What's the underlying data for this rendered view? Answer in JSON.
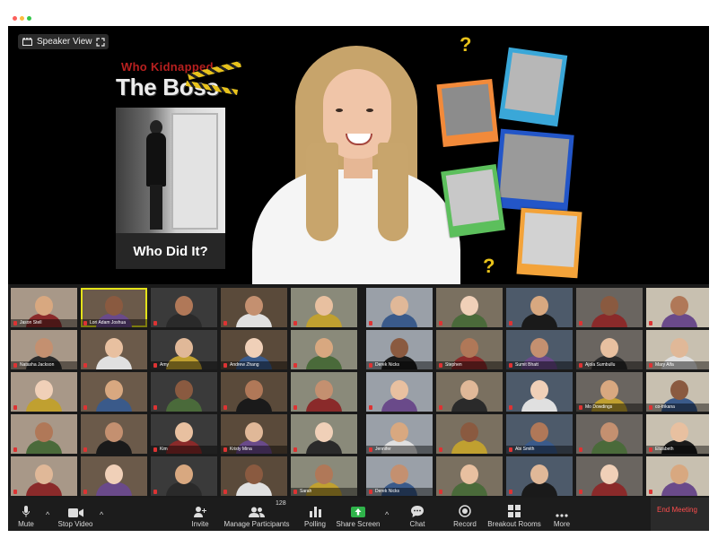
{
  "window": {
    "traffic_lights": [
      "#fc605c",
      "#fdbc40",
      "#34c84a"
    ]
  },
  "top_controls": {
    "speaker_view_label": "Speaker View"
  },
  "poster": {
    "title_line1": "Who Kidnapped",
    "title_line2": "The Boss",
    "caption": "Who Did It?"
  },
  "gallery": {
    "rows": [
      [
        "Jason Stell",
        "Lori Adam Joshua",
        "",
        "",
        "",
        "",
        "",
        "",
        "",
        ""
      ],
      [
        "Natasha Jackson",
        "",
        "Amy",
        "Andrew Zhang",
        "",
        "Derek Nicks",
        "Stephen",
        "Sumit Bhatt",
        "Ajola Sumbullu",
        "Mary Alfa"
      ],
      [
        "",
        "",
        "",
        "",
        "",
        "",
        "",
        "",
        "Mo Dowdings",
        "co-trikana"
      ],
      [
        "",
        "",
        "Kim",
        "Kristy Mina",
        "",
        "Jennifer",
        "",
        "Abi Smith",
        "",
        "Elizabeth"
      ],
      [
        "",
        "",
        "",
        "",
        "Sarah",
        "Derek Nicks",
        "",
        "",
        "",
        ""
      ]
    ],
    "active_tile": "Lori Adam Joshua"
  },
  "toolbar": {
    "mute": "Mute",
    "stop_video": "Stop Video",
    "invite": "Invite",
    "manage_participants": "Manage Participants",
    "participant_count": "128",
    "polling": "Polling",
    "share_screen": "Share Screen",
    "chat": "Chat",
    "record": "Record",
    "breakout_rooms": "Breakout Rooms",
    "more": "More",
    "end_meeting": "End Meeting"
  },
  "colors": {
    "share_screen_accent": "#2fb34a",
    "end_meeting": "#ff4d4d",
    "active_speaker_border": "#e4e21a",
    "question_mark": "#e8c21a"
  }
}
